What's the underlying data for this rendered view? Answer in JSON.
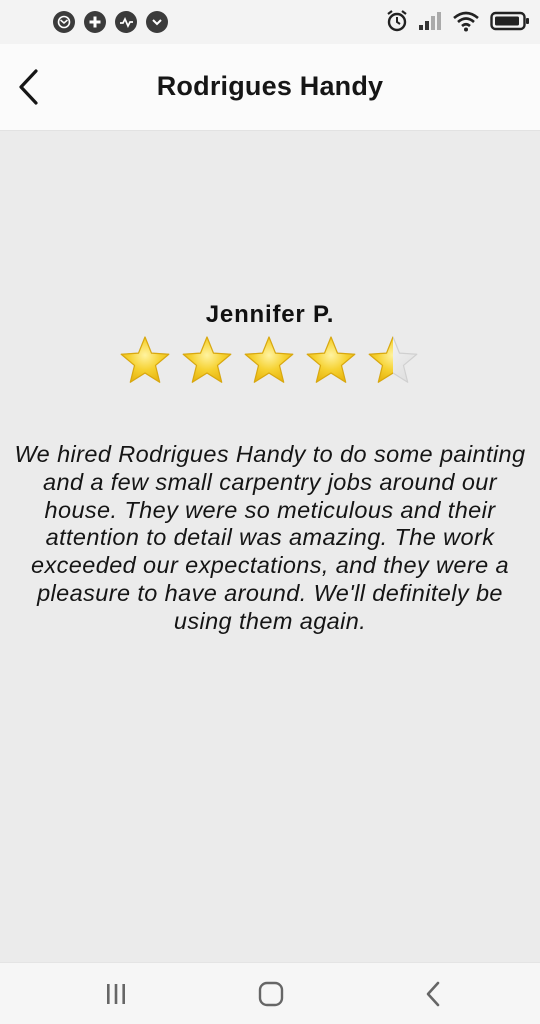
{
  "status_bar": {
    "left_icons": [
      "mail-notification-icon",
      "medical-app-icon",
      "pulse-app-icon",
      "chevron-down-circle-icon"
    ],
    "right_icons": [
      "alarm-icon",
      "signal-icon",
      "wifi-icon",
      "battery-icon"
    ]
  },
  "app_bar": {
    "back_icon": "chevron-left-icon",
    "title": "Rodrigues Handy"
  },
  "review": {
    "reviewer": "Jennifer P.",
    "rating": 4.5,
    "max_rating": 5,
    "text": "We hired Rodrigues Handy to do some painting and a few small carpentry jobs around our house. They were so meticulous and their attention to detail was amazing. The work exceeded our expectations, and they were a pleasure to have around. We'll definitely be using them again."
  },
  "nav_bar": {
    "icons": [
      "recent-apps-icon",
      "home-icon",
      "back-icon"
    ]
  },
  "colors": {
    "star_fill": "#f5c825",
    "star_empty": "#e4e4e4",
    "background": "#ebebeb"
  }
}
